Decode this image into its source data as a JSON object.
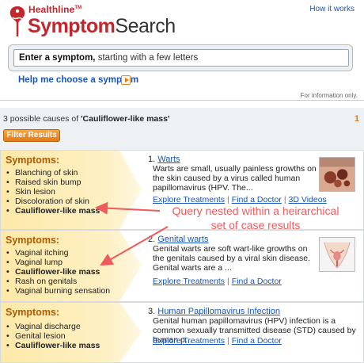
{
  "header": {
    "brand": "Healthline",
    "brand_tm": "TM",
    "product_light": "Symptom",
    "product_bold": "Search",
    "how_link": "How it works",
    "search_bold": "Enter a symptom,",
    "search_rest": " starting with a few letters",
    "help_link": "Help me choose a symptom",
    "info_only": "For information only."
  },
  "results": {
    "count_prefix": "3 possible causes of ",
    "query": "'Cauliflower-like mass'",
    "page": "1",
    "filter_button": "Filter Results",
    "items": [
      {
        "symptoms_label": "Symptoms:",
        "symptoms": [
          "Blanching of skin",
          "Raised skin bump",
          "Skin lesion",
          "Discoloration of skin",
          "Cauliflower-like mass"
        ],
        "number": "1.",
        "title": "Warts",
        "desc": "Warts are small, usually painless growths on the skin caused by a virus called human papillomavirus (HPV. The...",
        "action1": "Explore Treatments",
        "action2": "Find a Doctor",
        "action3": "3D Videos"
      },
      {
        "symptoms_label": "Symptoms:",
        "symptoms": [
          "Vaginal itching",
          "Vaginal lump",
          "Cauliflower-like mass",
          "Rash on genitals",
          "Vaginal burning sensation"
        ],
        "number": "2.",
        "title": "Genital warts",
        "desc": "Genital warts are soft wart-like growths on the genitals caused by a viral skin disease. Genital warts are a ...",
        "action1": "Explore Treatments",
        "action2": "Find a Doctor"
      },
      {
        "symptoms_label": "Symptoms:",
        "symptoms": [
          "Vaginal discharge",
          "Genital lesion",
          "Cauliflower-like mass"
        ],
        "number": "3.",
        "title": "Human Papillomavirus Infection",
        "desc": "Genital human papillomavirus (HPV) infection is a common sexually transmitted disease (STD) caused by human p...",
        "action1": "Explore Treatments",
        "action2": "Find a Doctor"
      }
    ]
  },
  "annotation": {
    "line1": "Query nested within a heirarchical",
    "line2": "set of case results",
    "color": "#ef5a5a"
  },
  "colors": {
    "brand_red": "#c1272d",
    "link_blue": "#1a56b5",
    "accent_orange": "#e07b1a",
    "panel_yellow": "#fde9a8"
  },
  "icons": [
    "healthline-logo-icon",
    "arrow-right-icon",
    "warts-photo",
    "anatomy-illustration"
  ]
}
